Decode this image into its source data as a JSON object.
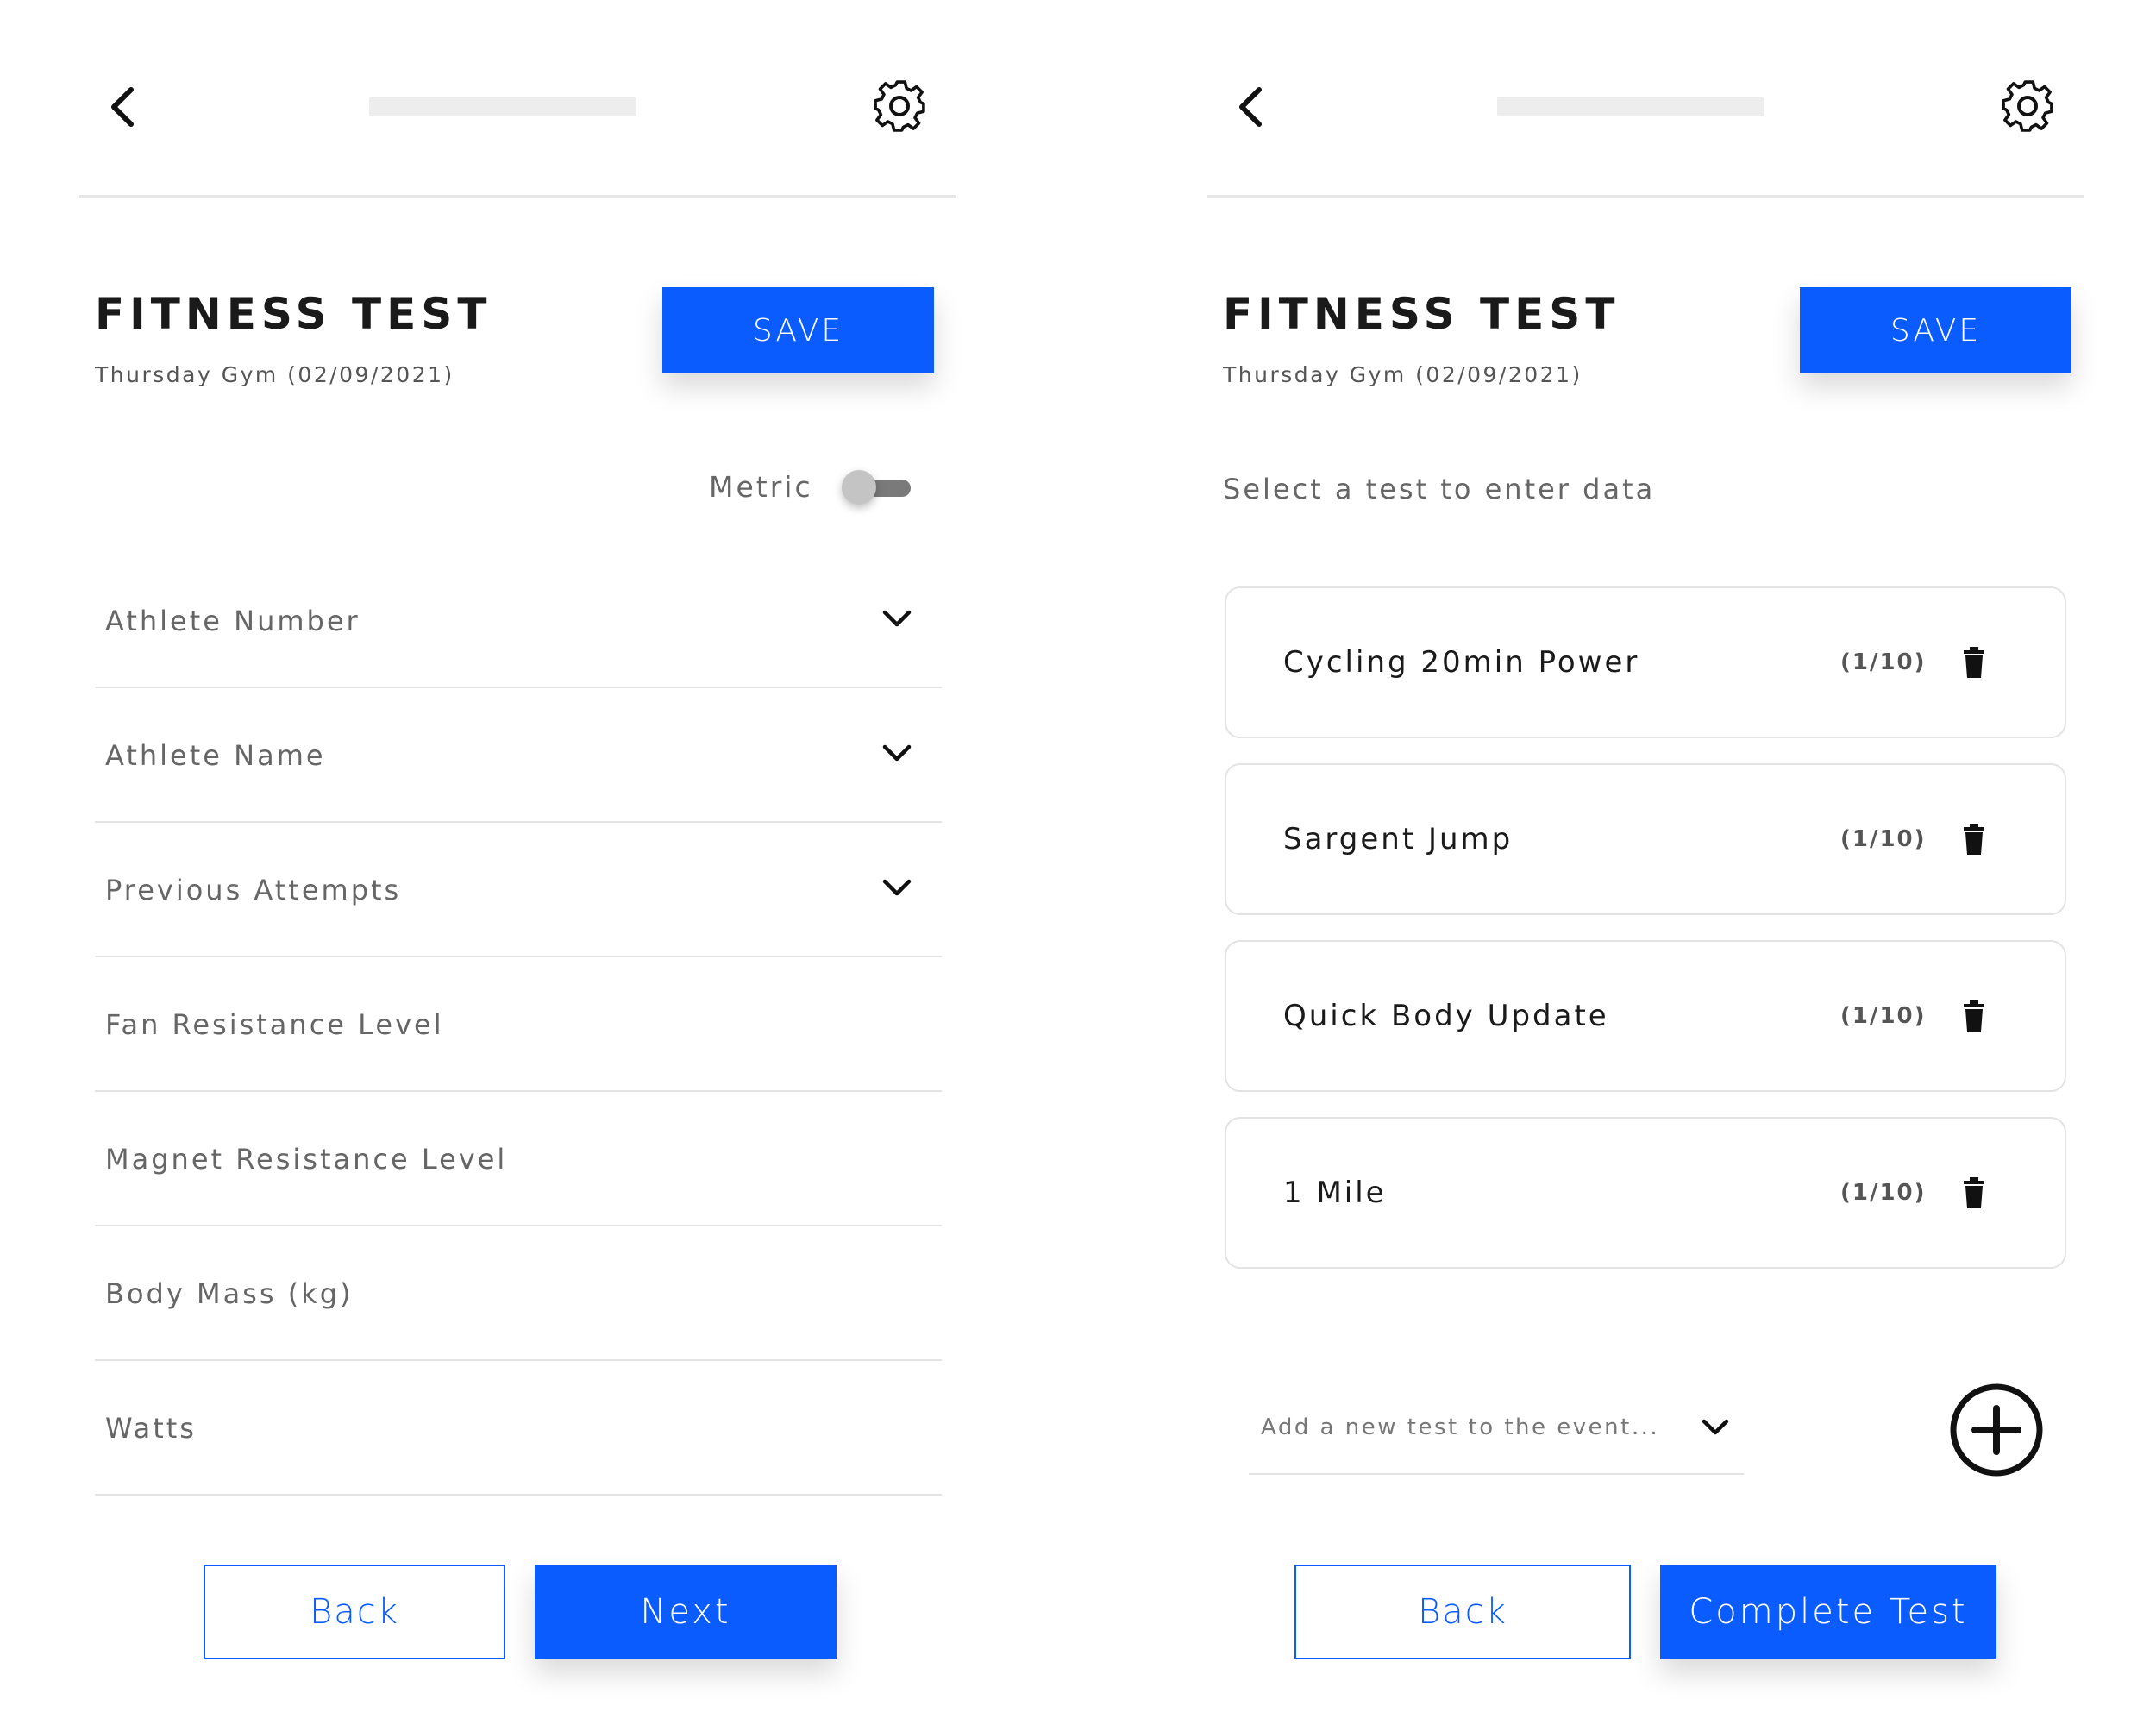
{
  "colors": {
    "primary": "#0b5cff",
    "divider": "#e3e3e3",
    "muted_text": "#666666"
  },
  "left_screen": {
    "header": {
      "back_icon": "chevron-left-icon",
      "settings_icon": "gear-icon"
    },
    "title": "FITNESS TEST",
    "subtitle": "Thursday Gym (02/09/2021)",
    "save_label": "SAVE",
    "metric": {
      "label": "Metric",
      "enabled": false
    },
    "fields": [
      {
        "label": "Athlete Number",
        "dropdown": true
      },
      {
        "label": "Athlete Name",
        "dropdown": true
      },
      {
        "label": "Previous Attempts",
        "dropdown": true
      },
      {
        "label": "Fan Resistance Level",
        "dropdown": false
      },
      {
        "label": "Magnet Resistance Level",
        "dropdown": false
      },
      {
        "label": "Body Mass (kg)",
        "dropdown": false
      },
      {
        "label": "Watts",
        "dropdown": false
      }
    ],
    "back_label": "Back",
    "next_label": "Next"
  },
  "right_screen": {
    "header": {
      "back_icon": "chevron-left-icon",
      "settings_icon": "gear-icon"
    },
    "title": "FITNESS TEST",
    "subtitle": "Thursday Gym (02/09/2021)",
    "save_label": "SAVE",
    "instruction": "Select a test to enter data",
    "tests": [
      {
        "name": "Cycling 20min Power",
        "count": "(1/10)"
      },
      {
        "name": "Sargent Jump",
        "count": "(1/10)"
      },
      {
        "name": "Quick Body Update",
        "count": "(1/10)"
      },
      {
        "name": "1 Mile",
        "count": "(1/10)"
      }
    ],
    "add_test_placeholder": "Add a new test to the event...",
    "back_label": "Back",
    "complete_label": "Complete Test"
  }
}
